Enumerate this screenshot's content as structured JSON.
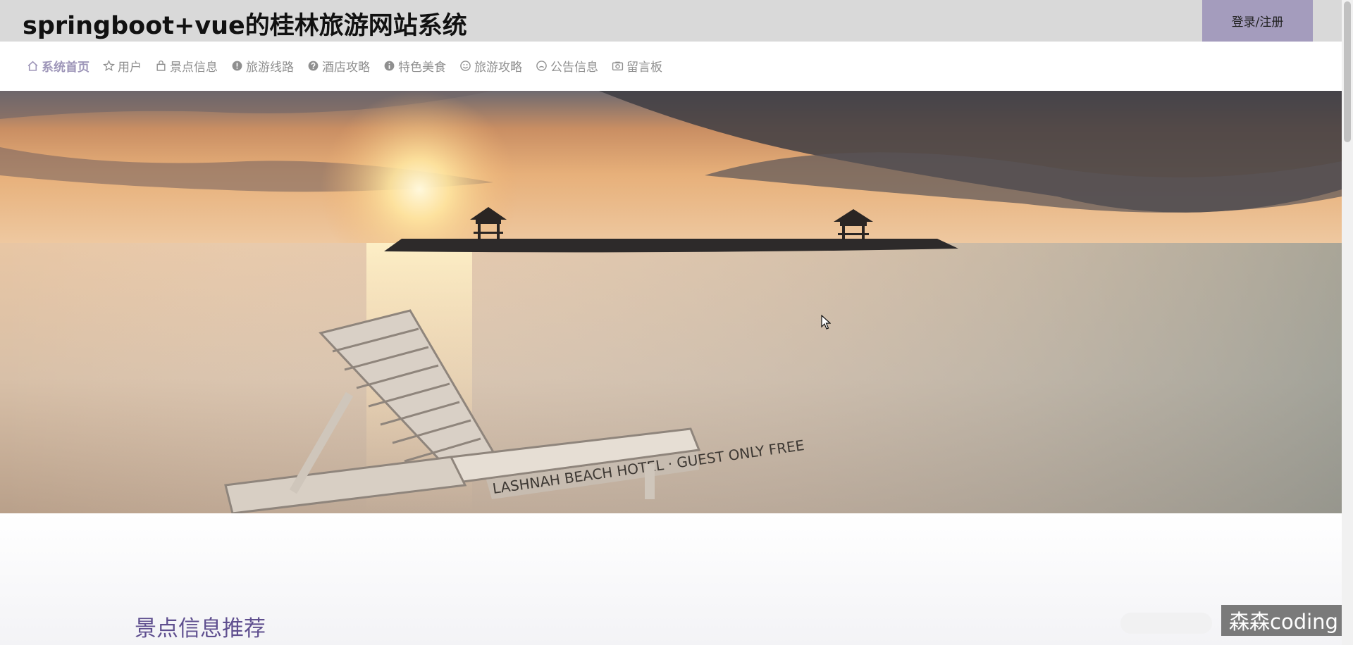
{
  "header": {
    "title": "springboot+vue的桂林旅游网站系统",
    "login_label": "登录/注册"
  },
  "nav": {
    "items": [
      {
        "label": "系统首页",
        "icon": "home-icon",
        "active": true
      },
      {
        "label": "用户",
        "icon": "star-icon"
      },
      {
        "label": "景点信息",
        "icon": "bag-icon"
      },
      {
        "label": "旅游线路",
        "icon": "warning-icon"
      },
      {
        "label": "酒店攻略",
        "icon": "question-icon"
      },
      {
        "label": "特色美食",
        "icon": "info-icon"
      },
      {
        "label": "旅游攻略",
        "icon": "smile-icon"
      },
      {
        "label": "公告信息",
        "icon": "face-icon"
      },
      {
        "label": "留言板",
        "icon": "camera-icon"
      }
    ]
  },
  "banner": {
    "scene": "sunset-lake-with-lounge-chair"
  },
  "section": {
    "title": "景点信息推荐"
  },
  "watermark": {
    "text": "森森coding"
  },
  "colors": {
    "topbar": "#d9d9d9",
    "login_button": "#a49cbd",
    "nav_active": "#9d95b8",
    "nav_text": "#8f8f8f",
    "section_title": "#5f4f8f"
  }
}
